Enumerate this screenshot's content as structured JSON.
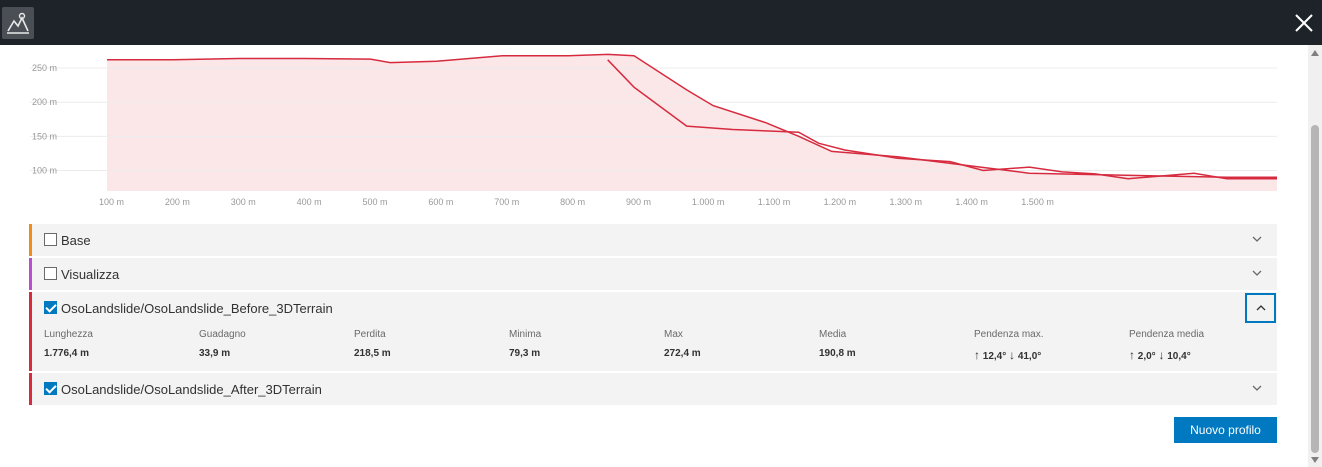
{
  "window": {
    "app_icon": "elevation-profile-icon",
    "close_icon": "close-icon"
  },
  "chart_data": {
    "type": "area",
    "ylabel_ticks": [
      "250 m",
      "200 m",
      "150 m",
      "100 m"
    ],
    "xlabel_ticks": [
      "100 m",
      "200 m",
      "300 m",
      "400 m",
      "500 m",
      "600 m",
      "700 m",
      "800 m",
      "900 m",
      "1.000 m",
      "1.100 m",
      "1.200 m",
      "1.300 m",
      "1.400 m",
      "1.500 m"
    ],
    "series": [
      {
        "name": "OsoLandslide/OsoLandslide_Before_3DTerrain",
        "color": "#d62b3f",
        "fill": "#fbe6e8",
        "x": [
          0,
          100,
          200,
          300,
          400,
          430,
          500,
          600,
          700,
          760,
          800,
          880,
          920,
          1000,
          1050,
          1100,
          1200,
          1300,
          1400,
          1500,
          1600,
          1700,
          1776
        ],
        "y": [
          262,
          262,
          264,
          264,
          263,
          258,
          260,
          268,
          268,
          270,
          268,
          218,
          195,
          170,
          150,
          128,
          120,
          108,
          96,
          94,
          92,
          90,
          90
        ]
      },
      {
        "name": "OsoLandslide/OsoLandslide_After_3DTerrain",
        "color": "#d62b3f",
        "x": [
          760,
          800,
          880,
          950,
          1000,
          1050,
          1080,
          1120,
          1200,
          1280,
          1330,
          1400,
          1450,
          1500,
          1550,
          1600,
          1650,
          1700,
          1776
        ],
        "y": [
          262,
          222,
          165,
          160,
          158,
          156,
          140,
          130,
          118,
          113,
          100,
          105,
          98,
          95,
          88,
          92,
          96,
          88,
          88
        ]
      }
    ]
  },
  "panels": [
    {
      "label": "Base",
      "checked": false,
      "color": "#f08c1a",
      "expanded": false
    },
    {
      "label": "Visualizza",
      "checked": false,
      "color": "#b84fd0",
      "expanded": false
    },
    {
      "label": "OsoLandslide/OsoLandslide_Before_3DTerrain",
      "checked": true,
      "color": "#d62b3f",
      "expanded": true
    },
    {
      "label": "OsoLandslide/OsoLandslide_After_3DTerrain",
      "checked": true,
      "color": "#d62b3f",
      "expanded": false
    }
  ],
  "stats": {
    "length": {
      "label": "Lunghezza",
      "value": "1.776,4 m"
    },
    "gain": {
      "label": "Guadagno",
      "value": "33,9 m"
    },
    "loss": {
      "label": "Perdita",
      "value": "218,5 m"
    },
    "min": {
      "label": "Minima",
      "value": "79,3 m"
    },
    "max": {
      "label": "Max",
      "value": "272,4 m"
    },
    "avg": {
      "label": "Media",
      "value": "190,8 m"
    },
    "max_slope": {
      "label": "Pendenza max.",
      "up": "12,4°",
      "down": "41,0°"
    },
    "avg_slope": {
      "label": "Pendenza media",
      "up": "2,0°",
      "down": "10,4°"
    }
  },
  "new_profile_button": "Nuovo profilo"
}
